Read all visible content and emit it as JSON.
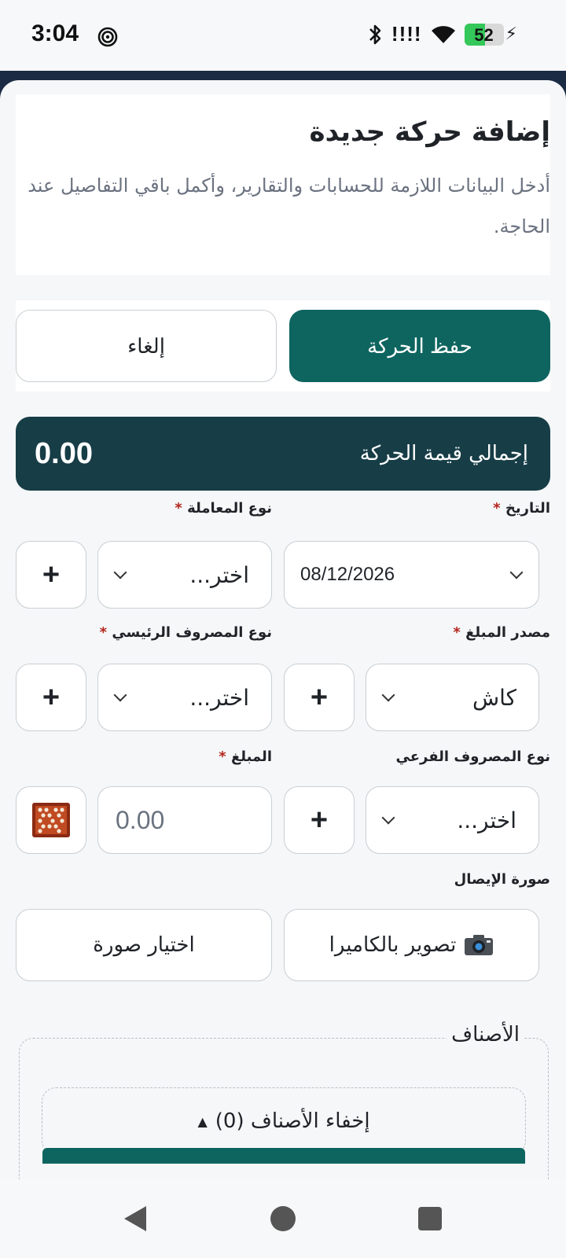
{
  "status_bar": {
    "time": "3:04",
    "signal": "!!!!",
    "battery_level": 52,
    "battery_text": "52",
    "battery_color": "#34c759"
  },
  "header": {
    "title": "إضافة حركة جديدة",
    "subtitle": "أدخل البيانات اللازمة للحسابات والتقارير، وأكمل باقي التفاصيل عند الحاجة."
  },
  "actions": {
    "save_label": "حفظ الحركة",
    "cancel_label": "إلغاء",
    "save_color": "#0e6560"
  },
  "total": {
    "label": "إجمالي قيمة الحركة",
    "amount": "0.00"
  },
  "form": {
    "date": {
      "label": "التاريخ",
      "value": "08/12/2026"
    },
    "transaction_type": {
      "label": "نوع المعاملة",
      "value": "اختر..."
    },
    "amount_source": {
      "label": "مصدر المبلغ",
      "value": "كاش"
    },
    "main_expense_type": {
      "label": "نوع المصروف الرئيسي",
      "value": "اختر..."
    },
    "sub_expense_type": {
      "label": "نوع المصروف الفرعي",
      "value": "اختر..."
    },
    "amount": {
      "label": "المبلغ",
      "placeholder": "0.00"
    },
    "receipt": {
      "label": "صورة الإيصال",
      "camera_label": "تصوير بالكاميرا",
      "pick_label": "اختيار صورة"
    },
    "required_mark": "*",
    "add_symbol": "+"
  },
  "items_section": {
    "legend": "الأصناف",
    "toggle_label": "إخفاء الأصناف (0)",
    "toggle_arrow": "▲"
  },
  "icons": {
    "spiral": "spiral-icon",
    "bluetooth": "bluetooth-icon",
    "wifi": "wifi-icon",
    "calculator": "abacus-icon",
    "camera": "camera-icon"
  }
}
